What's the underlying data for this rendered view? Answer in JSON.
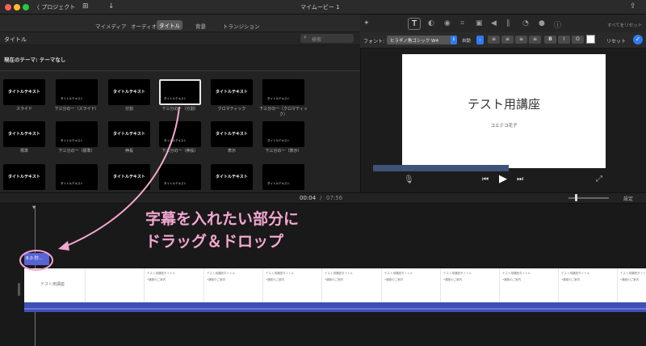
{
  "titlebar": {
    "back": "〈 プロジェクト",
    "title": "マイムービー 1"
  },
  "browser_tabs": [
    "マイメディア",
    "オーディオ",
    "タイトル",
    "背景",
    "トランジション"
  ],
  "section": {
    "label": "タイトル",
    "search_placeholder": "検索",
    "theme": "現在のテーマ: テーマなし"
  },
  "titles": [
    {
      "name": "スライド",
      "text": "タイトルテキスト"
    },
    {
      "name": "下三分の一（スライド）",
      "text": "タイトルテキスト"
    },
    {
      "name": "分割",
      "text": "タイトルテキスト"
    },
    {
      "name": "下三分の一（分割）",
      "text": "タイトルテキスト"
    },
    {
      "name": "クロマティック",
      "text": "タイトルテキスト"
    },
    {
      "name": "下三分の一（クロマティック）",
      "text": "タイトルテキスト"
    },
    {
      "name": "標準",
      "text": "タイトルテキスト"
    },
    {
      "name": "下三分の一（標準）",
      "text": "タイトルテキスト"
    },
    {
      "name": "伸長",
      "text": "タイトルテキスト"
    },
    {
      "name": "下三分の一（伸長）",
      "text": "タイトルテキスト"
    },
    {
      "name": "表示",
      "text": "タイトルテキスト"
    },
    {
      "name": "下三分の一（表示）",
      "text": "タイトルテキスト"
    },
    {
      "name": "",
      "text": "タイトルテキスト"
    },
    {
      "name": "",
      "text": "タイトルテキスト"
    },
    {
      "name": "",
      "text": "タイトルテキスト"
    },
    {
      "name": "",
      "text": "タイトルテキスト"
    },
    {
      "name": "",
      "text": "タイトルテキスト"
    },
    {
      "name": "",
      "text": "タイトルテキスト"
    }
  ],
  "viewer": {
    "reset_all": "すべてをリセット",
    "font_label": "フォント:",
    "font_value": "ヒラギノ角ゴシック W4",
    "size_label": "自動",
    "bold": "B",
    "italic": "I",
    "outline": "O",
    "reset": "リセット",
    "preview_title": "テスト用講座",
    "preview_sub": "コエテコ花子"
  },
  "timeline": {
    "current": "00:04",
    "total": "07:56",
    "settings": "設定",
    "title_clip": "8.0 秒...",
    "clip_title": "テスト用講座",
    "clip_frame_text": "テスト用講座タイトル",
    "clip_frame_sub": "•講座のご案内"
  },
  "annotation": {
    "line1": "字幕を入れたい部分に",
    "line2": "ドラッグ＆ドロップ"
  },
  "colors": {
    "annotation_pink": "#f3a6cf",
    "audio_blue": "#3e4fb8",
    "title_clip_blue": "#5a63d6",
    "checkmark_blue": "#2f7bf6"
  }
}
